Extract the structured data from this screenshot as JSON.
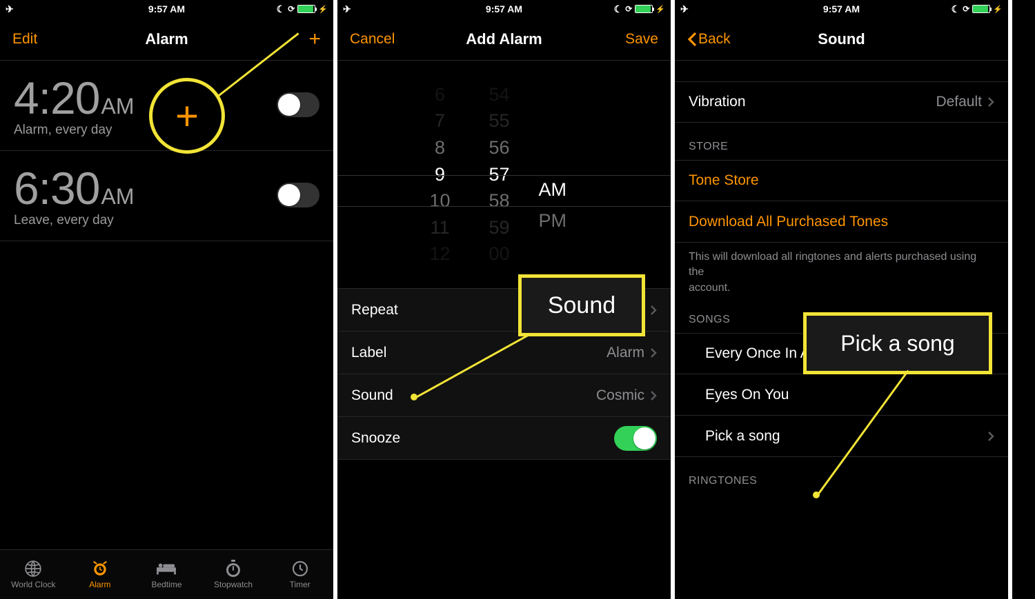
{
  "status": {
    "time": "9:57 AM"
  },
  "screen1": {
    "nav": {
      "left": "Edit",
      "title": "Alarm",
      "plus": "+"
    },
    "alarms": [
      {
        "time": "4:20",
        "ampm": "AM",
        "sub": "Alarm, every day",
        "on": false
      },
      {
        "time": "6:30",
        "ampm": "AM",
        "sub": "Leave, every day",
        "on": false
      }
    ],
    "tabs": [
      {
        "label": "World Clock"
      },
      {
        "label": "Alarm"
      },
      {
        "label": "Bedtime"
      },
      {
        "label": "Stopwatch"
      },
      {
        "label": "Timer"
      }
    ]
  },
  "screen2": {
    "nav": {
      "left": "Cancel",
      "title": "Add Alarm",
      "right": "Save"
    },
    "picker": {
      "hours": [
        "6",
        "7",
        "8",
        "9",
        "10",
        "11",
        "12"
      ],
      "minutes": [
        "54",
        "55",
        "56",
        "57",
        "58",
        "59",
        "00"
      ],
      "ampm": [
        "AM",
        "PM"
      ]
    },
    "rows": {
      "repeat": "Repeat",
      "labelrow": "Label",
      "labelval": "Alarm",
      "sound": "Sound",
      "soundval": "Cosmic",
      "snooze": "Snooze"
    },
    "annot": "Sound"
  },
  "screen3": {
    "nav": {
      "back": "Back",
      "title": "Sound"
    },
    "vibration": {
      "label": "Vibration",
      "value": "Default"
    },
    "storeHeader": "STORE",
    "store": [
      "Tone Store",
      "Download All Purchased Tones"
    ],
    "storeFooter": "This will download all ringtones and alerts purchased using the\naccount.",
    "songsHeader": "SONGS",
    "songs": [
      "Every Once In A While",
      "Eyes On You",
      "Pick a song"
    ],
    "ringtonesHeader": "RINGTONES",
    "annot": "Pick a song"
  }
}
